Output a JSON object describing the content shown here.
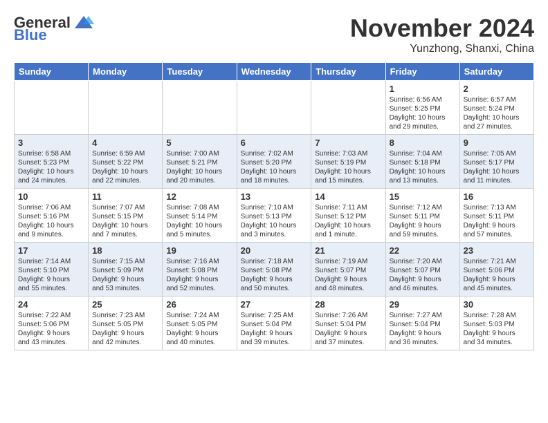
{
  "logo": {
    "general": "General",
    "blue": "Blue"
  },
  "title": "November 2024",
  "subtitle": "Yunzhong, Shanxi, China",
  "days_header": [
    "Sunday",
    "Monday",
    "Tuesday",
    "Wednesday",
    "Thursday",
    "Friday",
    "Saturday"
  ],
  "weeks": [
    [
      {
        "day": "",
        "info": ""
      },
      {
        "day": "",
        "info": ""
      },
      {
        "day": "",
        "info": ""
      },
      {
        "day": "",
        "info": ""
      },
      {
        "day": "",
        "info": ""
      },
      {
        "day": "1",
        "info": "Sunrise: 6:56 AM\nSunset: 5:25 PM\nDaylight: 10 hours\nand 29 minutes."
      },
      {
        "day": "2",
        "info": "Sunrise: 6:57 AM\nSunset: 5:24 PM\nDaylight: 10 hours\nand 27 minutes."
      }
    ],
    [
      {
        "day": "3",
        "info": "Sunrise: 6:58 AM\nSunset: 5:23 PM\nDaylight: 10 hours\nand 24 minutes."
      },
      {
        "day": "4",
        "info": "Sunrise: 6:59 AM\nSunset: 5:22 PM\nDaylight: 10 hours\nand 22 minutes."
      },
      {
        "day": "5",
        "info": "Sunrise: 7:00 AM\nSunset: 5:21 PM\nDaylight: 10 hours\nand 20 minutes."
      },
      {
        "day": "6",
        "info": "Sunrise: 7:02 AM\nSunset: 5:20 PM\nDaylight: 10 hours\nand 18 minutes."
      },
      {
        "day": "7",
        "info": "Sunrise: 7:03 AM\nSunset: 5:19 PM\nDaylight: 10 hours\nand 15 minutes."
      },
      {
        "day": "8",
        "info": "Sunrise: 7:04 AM\nSunset: 5:18 PM\nDaylight: 10 hours\nand 13 minutes."
      },
      {
        "day": "9",
        "info": "Sunrise: 7:05 AM\nSunset: 5:17 PM\nDaylight: 10 hours\nand 11 minutes."
      }
    ],
    [
      {
        "day": "10",
        "info": "Sunrise: 7:06 AM\nSunset: 5:16 PM\nDaylight: 10 hours\nand 9 minutes."
      },
      {
        "day": "11",
        "info": "Sunrise: 7:07 AM\nSunset: 5:15 PM\nDaylight: 10 hours\nand 7 minutes."
      },
      {
        "day": "12",
        "info": "Sunrise: 7:08 AM\nSunset: 5:14 PM\nDaylight: 10 hours\nand 5 minutes."
      },
      {
        "day": "13",
        "info": "Sunrise: 7:10 AM\nSunset: 5:13 PM\nDaylight: 10 hours\nand 3 minutes."
      },
      {
        "day": "14",
        "info": "Sunrise: 7:11 AM\nSunset: 5:12 PM\nDaylight: 10 hours\nand 1 minute."
      },
      {
        "day": "15",
        "info": "Sunrise: 7:12 AM\nSunset: 5:11 PM\nDaylight: 9 hours\nand 59 minutes."
      },
      {
        "day": "16",
        "info": "Sunrise: 7:13 AM\nSunset: 5:11 PM\nDaylight: 9 hours\nand 57 minutes."
      }
    ],
    [
      {
        "day": "17",
        "info": "Sunrise: 7:14 AM\nSunset: 5:10 PM\nDaylight: 9 hours\nand 55 minutes."
      },
      {
        "day": "18",
        "info": "Sunrise: 7:15 AM\nSunset: 5:09 PM\nDaylight: 9 hours\nand 53 minutes."
      },
      {
        "day": "19",
        "info": "Sunrise: 7:16 AM\nSunset: 5:08 PM\nDaylight: 9 hours\nand 52 minutes."
      },
      {
        "day": "20",
        "info": "Sunrise: 7:18 AM\nSunset: 5:08 PM\nDaylight: 9 hours\nand 50 minutes."
      },
      {
        "day": "21",
        "info": "Sunrise: 7:19 AM\nSunset: 5:07 PM\nDaylight: 9 hours\nand 48 minutes."
      },
      {
        "day": "22",
        "info": "Sunrise: 7:20 AM\nSunset: 5:07 PM\nDaylight: 9 hours\nand 46 minutes."
      },
      {
        "day": "23",
        "info": "Sunrise: 7:21 AM\nSunset: 5:06 PM\nDaylight: 9 hours\nand 45 minutes."
      }
    ],
    [
      {
        "day": "24",
        "info": "Sunrise: 7:22 AM\nSunset: 5:06 PM\nDaylight: 9 hours\nand 43 minutes."
      },
      {
        "day": "25",
        "info": "Sunrise: 7:23 AM\nSunset: 5:05 PM\nDaylight: 9 hours\nand 42 minutes."
      },
      {
        "day": "26",
        "info": "Sunrise: 7:24 AM\nSunset: 5:05 PM\nDaylight: 9 hours\nand 40 minutes."
      },
      {
        "day": "27",
        "info": "Sunrise: 7:25 AM\nSunset: 5:04 PM\nDaylight: 9 hours\nand 39 minutes."
      },
      {
        "day": "28",
        "info": "Sunrise: 7:26 AM\nSunset: 5:04 PM\nDaylight: 9 hours\nand 37 minutes."
      },
      {
        "day": "29",
        "info": "Sunrise: 7:27 AM\nSunset: 5:04 PM\nDaylight: 9 hours\nand 36 minutes."
      },
      {
        "day": "30",
        "info": "Sunrise: 7:28 AM\nSunset: 5:03 PM\nDaylight: 9 hours\nand 34 minutes."
      }
    ]
  ]
}
